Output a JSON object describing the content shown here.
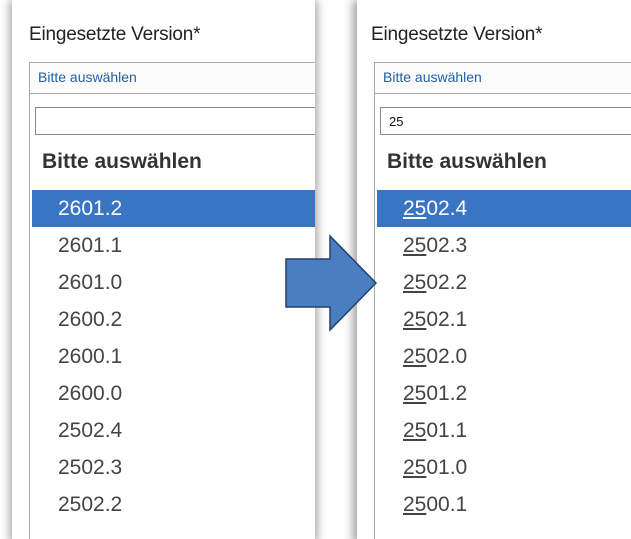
{
  "left_panel": {
    "label": "Eingesetzte Version*",
    "select_text": "Bitte auswählen",
    "filter_value": "",
    "group_header": "Bitte auswählen",
    "options": [
      "2601.2",
      "2601.1",
      "2601.0",
      "2600.2",
      "2600.1",
      "2600.0",
      "2502.4",
      "2502.3",
      "2502.2"
    ],
    "selected_index": 0
  },
  "right_panel": {
    "label": "Eingesetzte Version*",
    "select_text": "Bitte auswählen",
    "filter_value": "25",
    "group_header": "Bitte auswählen",
    "match_prefix": "25",
    "options": [
      "2502.4",
      "2502.3",
      "2502.2",
      "2502.1",
      "2502.0",
      "2501.2",
      "2501.1",
      "2501.0",
      "2500.1"
    ],
    "selected_index": 0
  },
  "colors": {
    "selected_bg": "#3a75c4",
    "link_text": "#1f5faa",
    "arrow_fill": "#4a7ec0",
    "arrow_stroke": "#23416b"
  },
  "arrow_icon": "right-arrow-icon"
}
